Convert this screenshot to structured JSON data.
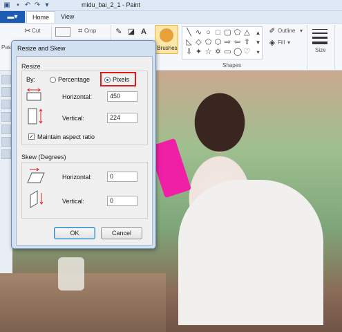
{
  "window": {
    "title": "midu_bai_2_1 - Paint"
  },
  "tabs": {
    "file_icon": "file-menu-icon",
    "home": "Home",
    "view": "View"
  },
  "ribbon": {
    "cut": "Cut",
    "crop": "Crop",
    "brushes": "Brushes",
    "outline": "Outline",
    "fill": "Fill",
    "shapes_group": "Shapes",
    "size": "Size",
    "paste_partial": "Pas"
  },
  "dialog": {
    "title": "Resize and Skew",
    "resize": {
      "heading": "Resize",
      "by_label": "By:",
      "percentage_label": "Percentage",
      "pixels_label": "Pixels",
      "selected": "Pixels",
      "horizontal_label": "Horizontal:",
      "horizontal_value": "450",
      "vertical_label": "Vertical:",
      "vertical_value": "224",
      "maintain_aspect_label": "Maintain aspect ratio",
      "maintain_aspect_checked": true
    },
    "skew": {
      "heading": "Skew (Degrees)",
      "horizontal_label": "Horizontal:",
      "horizontal_value": "0",
      "vertical_label": "Vertical:",
      "vertical_value": "0"
    },
    "ok_label": "OK",
    "cancel_label": "Cancel"
  },
  "colors": {
    "highlight": "#e01a1a",
    "file_tab": "#1c5bb4",
    "brushes_active": "#fde7a8"
  }
}
